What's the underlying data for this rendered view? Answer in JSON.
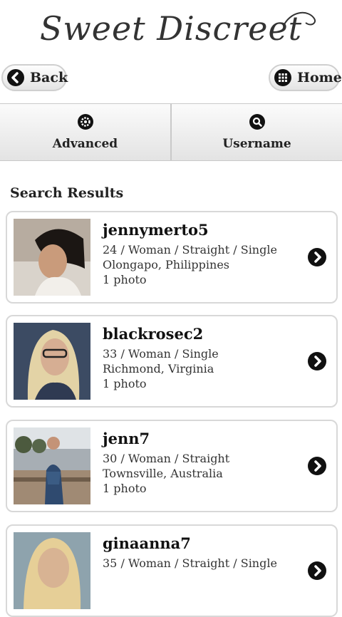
{
  "app": {
    "logo": "Sweet Discreet"
  },
  "nav": {
    "back_label": "Back",
    "home_label": "Home"
  },
  "tabs": [
    {
      "label": "Advanced",
      "icon": "gear-icon"
    },
    {
      "label": "Username",
      "icon": "search-icon"
    }
  ],
  "results": {
    "title": "Search Results",
    "items": [
      {
        "username": "jennymerto5",
        "details": "24 / Woman / Straight / Single",
        "location": "Olongapo, Philippines",
        "photos": "1 photo"
      },
      {
        "username": "blackrosec2",
        "details": "33 / Woman / Single",
        "location": "Richmond, Virginia",
        "photos": "1 photo"
      },
      {
        "username": "jenn7",
        "details": "30 / Woman / Straight",
        "location": "Townsville, Australia",
        "photos": "1 photo"
      },
      {
        "username": "ginaanna7",
        "details": "35 / Woman / Straight / Single",
        "location": "",
        "photos": ""
      }
    ]
  },
  "colors": {
    "icon_fill": "#111111",
    "button_border": "#cfcfcf",
    "card_border": "#d8d8d8"
  }
}
